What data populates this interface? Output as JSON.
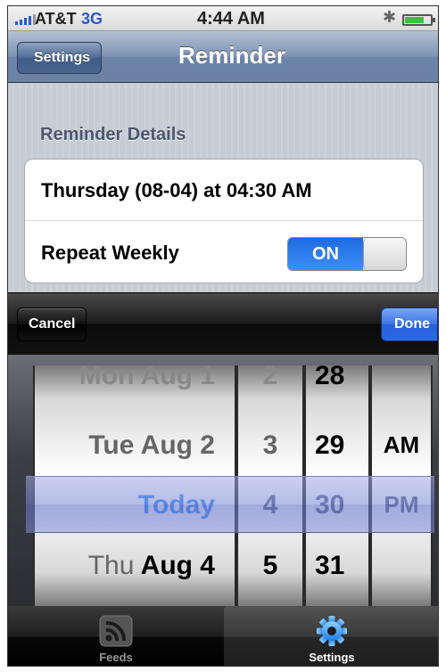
{
  "status_bar": {
    "carrier": "AT&T",
    "network": "3G",
    "time": "4:44 AM"
  },
  "nav": {
    "back_label": "Settings",
    "title": "Reminder"
  },
  "section": {
    "title": "Reminder Details"
  },
  "rows": {
    "datetime": "Thursday (08-04) at 04:30 AM",
    "repeat_label": "Repeat Weekly",
    "repeat_toggle": "ON"
  },
  "toolbar": {
    "cancel_label": "Cancel",
    "done_label": "Done"
  },
  "picker": {
    "dates": [
      "Mon Aug 1",
      "Tue Aug 2",
      "Today",
      "Thu"
    ],
    "date_bold_suffix": "Aug 4",
    "hours": [
      "2",
      "3",
      "4",
      "5"
    ],
    "minutes": [
      "28",
      "29",
      "30",
      "31"
    ],
    "ampm": [
      "",
      "AM",
      "PM",
      ""
    ]
  },
  "tabs": {
    "feeds_label": "Feeds",
    "settings_label": "Settings"
  },
  "colors": {
    "nav_blue": "#6c84a8",
    "toggle_blue": "#2a76ee",
    "done_blue": "#2c68e0",
    "today_blue": "#3d8cf0"
  }
}
